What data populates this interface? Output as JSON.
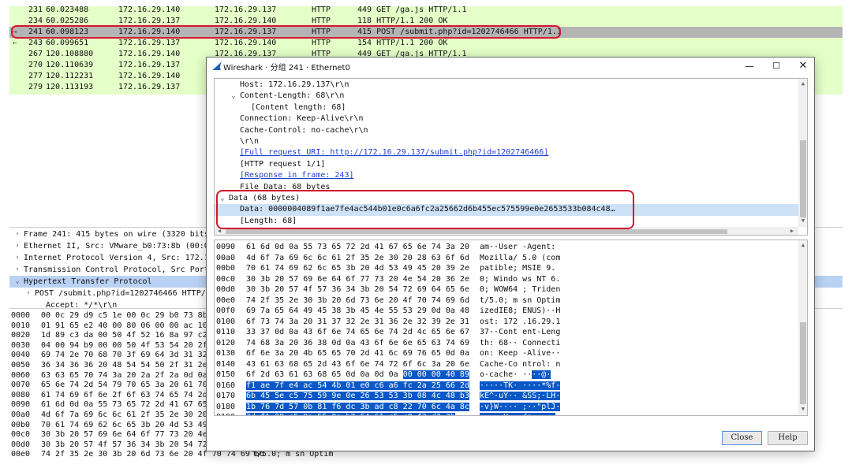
{
  "packet_list": {
    "rows": [
      {
        "no": "231",
        "time": "60.023488",
        "src": "172.16.29.140",
        "dst": "172.16.29.137",
        "proto": "HTTP",
        "info": "449 GET /ga.js HTTP/1.1"
      },
      {
        "no": "234",
        "time": "60.025286",
        "src": "172.16.29.137",
        "dst": "172.16.29.140",
        "proto": "HTTP",
        "info": "118 HTTP/1.1 200 OK"
      },
      {
        "no": "241",
        "time": "60.098123",
        "src": "172.16.29.140",
        "dst": "172.16.29.137",
        "proto": "HTTP",
        "info": "415 POST /submit.php?id=1202746466 HTTP/1.1"
      },
      {
        "no": "243",
        "time": "60.099651",
        "src": "172.16.29.137",
        "dst": "172.16.29.140",
        "proto": "HTTP",
        "info": "154 HTTP/1.1 200 OK"
      },
      {
        "no": "267",
        "time": "120.108880",
        "src": "172.16.29.140",
        "dst": "172.16.29.137",
        "proto": "HTTP",
        "info": "449 GET /ga.js HTTP/1.1"
      },
      {
        "no": "270",
        "time": "120.110639",
        "src": "172.16.29.137"
      },
      {
        "no": "277",
        "time": "120.112231",
        "src": "172.16.29.140"
      },
      {
        "no": "279",
        "time": "120.113193",
        "src": "172.16.29.137"
      }
    ],
    "selected_no": "241"
  },
  "details_tree": {
    "rows": [
      "Frame 241: 415 bytes on wire (3320 bits)",
      "Ethernet II, Src: VMware_b0:73:8b (00:0c",
      "Internet Protocol Version 4, Src: 172.16",
      "Transmission Control Protocol, Src Port:",
      "Hypertext Transfer Protocol",
      "POST /submit.php?id=1202746466 HTTP/1.",
      "Accept: */*\\r\\n"
    ]
  },
  "hex_background": {
    "rows": [
      {
        "off": "0000",
        "bytes": "00 0c 29 d9 c5 1e 00 0c  29 b0 73 8b"
      },
      {
        "off": "0010",
        "bytes": "01 91 65 e2 40 00 80 06  00 00 ac 10"
      },
      {
        "off": "0020",
        "bytes": "1d 89 c3 da 00 50 4f 52  16 8a 97 c2"
      },
      {
        "off": "0030",
        "bytes": "04 00 94 b9 00 00 50 4f  53 54 20 2f"
      },
      {
        "off": "0040",
        "bytes": "69 74 2e 70 68 70 3f 69  64 3d 31 32"
      },
      {
        "off": "0050",
        "bytes": "36 34 36 36 20 48 54 54  50 2f 31 2e"
      },
      {
        "off": "0060",
        "bytes": "63 63 65 70 74 3a 20 2a  2f 2a 0d 0a"
      },
      {
        "off": "0070",
        "bytes": "65 6e 74 2d 54 79 70 65  3a 20 61 70"
      },
      {
        "off": "0080",
        "bytes": "61 74 69 6f 6e 2f 6f 63  74 65 74 2d"
      },
      {
        "off": "0090",
        "bytes": "61 6d 0d 0a 55 73 65 72  2d 41 67 65"
      },
      {
        "off": "00a0",
        "bytes": "4d 6f 7a 69 6c 6c 61 2f  35 2e 30 20"
      },
      {
        "off": "00b0",
        "bytes": "70 61 74 69 62 6c 65 3b  20 4d 53 49"
      },
      {
        "off": "00c0",
        "bytes": "30 3b 20 57 69 6e 64 6f  77 73 20 4e"
      },
      {
        "off": "00d0",
        "bytes": "30 3b 20 57 4f 57 36 34  3b 20 54 72"
      },
      {
        "off": "00e0",
        "bytes": "74 2f 35 2e 30 3b 20 6d  73 6e 20 4f 70 74 69 6d",
        "ascii": "t/5.0; m sn Optim"
      }
    ]
  },
  "dialog": {
    "title": "Wireshark · 分组 241 · Ethernet0",
    "min_glyph": "—",
    "max_glyph": "☐",
    "close_glyph": "✕",
    "tree": [
      {
        "text": "Host: 172.16.29.137\\r\\n",
        "indent": 1,
        "arrow": ""
      },
      {
        "text": "Content-Length: 68\\r\\n",
        "indent": 1,
        "arrow": "⌄"
      },
      {
        "text": "[Content length: 68]",
        "indent": 2,
        "arrow": ""
      },
      {
        "text": "Connection: Keep-Alive\\r\\n",
        "indent": 1,
        "arrow": ""
      },
      {
        "text": "Cache-Control: no-cache\\r\\n",
        "indent": 1,
        "arrow": ""
      },
      {
        "text": "\\r\\n",
        "indent": 1,
        "arrow": ""
      },
      {
        "text": "[Full request URI: http://172.16.29.137/submit.php?id=1202746466]",
        "indent": 1,
        "arrow": "",
        "link": true
      },
      {
        "text": "[HTTP request 1/1]",
        "indent": 1,
        "arrow": ""
      },
      {
        "text": "[Response in frame: 243]",
        "indent": 1,
        "arrow": "",
        "link": true
      },
      {
        "text": "File Data: 68 bytes",
        "indent": 1,
        "arrow": ""
      },
      {
        "text": "Data (68 bytes)",
        "indent": 0,
        "arrow": "⌄"
      },
      {
        "text": "Data: 0000004089f1ae7fe4ac544b01e0c6a6fc2a25662d6b455ec575599e0e2653533b084c48…",
        "indent": 1,
        "arrow": "",
        "selected": true
      },
      {
        "text": "[Length: 68]",
        "indent": 1,
        "arrow": ""
      }
    ],
    "hex": [
      {
        "off": "0090",
        "bytes": "61 6d 0d 0a 55 73 65 72  2d 41 67 65 6e 74 3a 20",
        "ascii": "am··User -Agent: "
      },
      {
        "off": "00a0",
        "bytes": "4d 6f 7a 69 6c 6c 61 2f  35 2e 30 20 28 63 6f 6d",
        "ascii": "Mozilla/ 5.0 (com"
      },
      {
        "off": "00b0",
        "bytes": "70 61 74 69 62 6c 65 3b  20 4d 53 49 45 20 39 2e",
        "ascii": "patible;  MSIE 9."
      },
      {
        "off": "00c0",
        "bytes": "30 3b 20 57 69 6e 64 6f  77 73 20 4e 54 20 36 2e",
        "ascii": "0; Windo ws NT 6."
      },
      {
        "off": "00d0",
        "bytes": "30 3b 20 57 4f 57 36 34  3b 20 54 72 69 64 65 6e",
        "ascii": "0; WOW64 ; Triden"
      },
      {
        "off": "00e0",
        "bytes": "74 2f 35 2e 30 3b 20 6d  73 6e 20 4f 70 74 69 6d",
        "ascii": "t/5.0; m sn Optim"
      },
      {
        "off": "00f0",
        "bytes": "69 7a 65 64 49 45 38 3b  45 4e 55 53 29 0d 0a 48",
        "ascii": "izedIE8; ENUS)··H"
      },
      {
        "off": "0100",
        "bytes": "6f 73 74 3a 20 31 37 32  2e 31 36 2e 32 39 2e 31",
        "ascii": "ost: 172 .16.29.1"
      },
      {
        "off": "0110",
        "bytes": "33 37 0d 0a 43 6f 6e 74  65 6e 74 2d 4c 65 6e 67",
        "ascii": "37··Cont ent-Leng"
      },
      {
        "off": "0120",
        "bytes": "74 68 3a 20 36 38 0d 0a  43 6f 6e 6e 65 63 74 69",
        "ascii": "th: 68·· Connecti"
      },
      {
        "off": "0130",
        "bytes": "6f 6e 3a 20 4b 65 65 70  2d 41 6c 69 76 65 0d 0a",
        "ascii": "on: Keep -Alive··"
      },
      {
        "off": "0140",
        "bytes": "43 61 63 68 65 2d 43 6f  6e 74 72 6f 6c 3a 20 6e",
        "ascii": "Cache-Co ntrol: n"
      },
      {
        "off": "0150",
        "bytes": "6f 2d 63 61 63 68 65 0d  0a 0d 0a ",
        "bytes_hl": "00 00 00 40 89",
        "ascii": "o-cache· ··",
        "ascii_hl": "··@·"
      },
      {
        "off": "0160",
        "bytes": "",
        "bytes_hl": "f1 ae 7f e4 ac 54 4b 01  e0 c6 a6 fc 2a 25 66 2d",
        "ascii": "",
        "ascii_hl": "·····TK· ····*%f-"
      },
      {
        "off": "0170",
        "bytes": "",
        "bytes_hl": "6b 45 5e c5 75 59 9e 0e  26 53 53 3b 08 4c 48 b3",
        "ascii": "",
        "ascii_hl": "kE^·uY·· &SS;·LH·"
      },
      {
        "off": "0180",
        "bytes": "",
        "bytes_hl": "1b 76 7d 57 0b 81 f6 dc  3b ad c8 22 70 6c 4a 8c",
        "ascii": "",
        "ascii_hl": "·v}W···· ;··\"plJ·"
      },
      {
        "off": "0190",
        "bytes": "",
        "bytes_hl": "3d f1 08 c5 9a 55 0a b2  64 61 c5 c8 f3 d2 3b",
        "ascii": "",
        "ascii_hl": "=····U·· da····;"
      }
    ],
    "close_label": "Close",
    "help_label": "Help"
  },
  "colors": {
    "packet_list_bg": "#e4ffc7",
    "selected_row": "#b4b4b4",
    "annotation_red": "#d3162f",
    "hex_highlight": "#0a58c7",
    "tree_selection": "#b9d2f4"
  }
}
